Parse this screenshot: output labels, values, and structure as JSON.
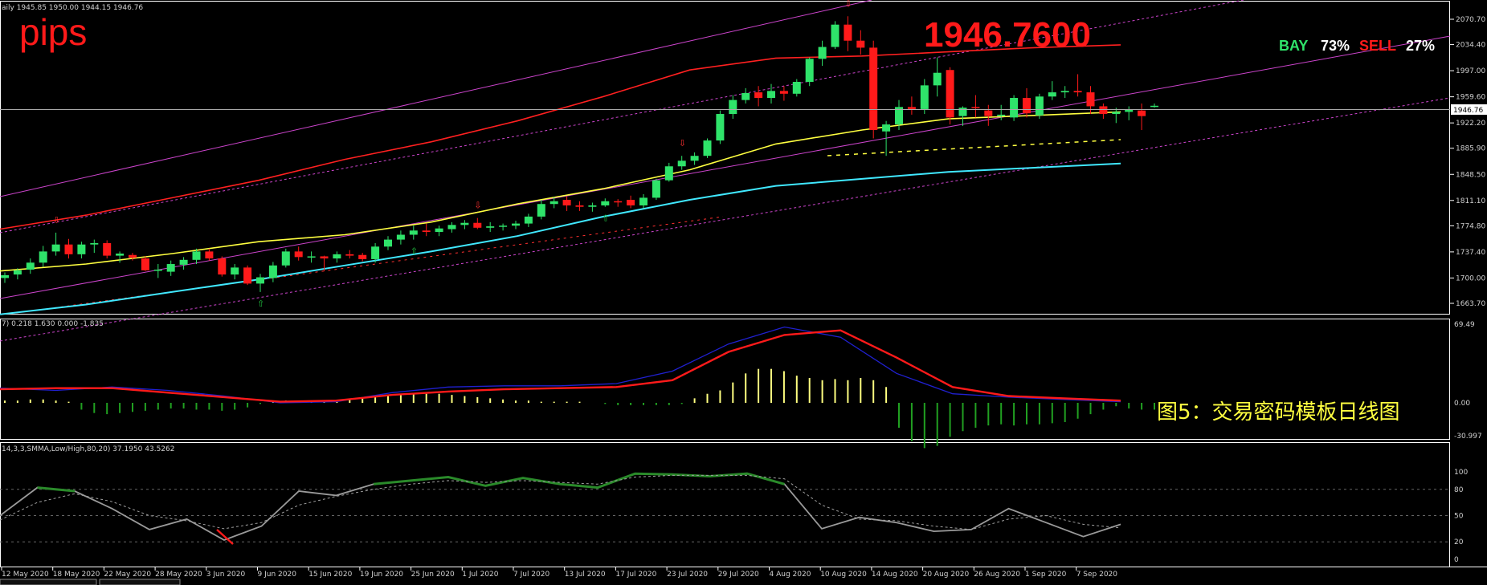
{
  "main_header": "aily  1945.85 1950.00 1944.15 1946.76",
  "watermark": "pips",
  "big_price": "1946.7600",
  "bay_label": "BAY",
  "bay_pct": "73%",
  "sell_label": "SELL",
  "sell_pct": "27%",
  "current_price_tag": "1946.76",
  "macd_header": "7) 0.218 1.630 0.000 -1.835",
  "stoch_header": "14,3,3,SMMA,Low/High,80,20) 37.1950 43.5262",
  "caption": "图5：交易密码模板日线图",
  "colors": {
    "bull": "#2fe36a",
    "bear": "#ff1a1a",
    "ma_fast": "#ffff40",
    "ma_slow": "#ff2020",
    "ma_cyan": "#40e8ff",
    "channel": "#cc44cc",
    "macd_main": "#ff1a1a",
    "macd_signal": "#2020d0",
    "hist_pos": "#ffff80",
    "hist_neg": "#21a021",
    "stoch_main": "#9a9a9a",
    "stoch_hi": "#2a8a2a"
  },
  "chart_data": [
    {
      "type": "candlestick",
      "panel": "price",
      "yticks": [
        "2070.70",
        "2034.40",
        "1997.00",
        "1959.60",
        "1922.20",
        "1885.90",
        "1848.50",
        "1811.10",
        "1774.80",
        "1737.40",
        "1700.00",
        "1663.70"
      ],
      "ylim": [
        1663.7,
        2082
      ],
      "xticks": [
        "12 May 2020",
        "18 May 2020",
        "22 May 2020",
        "28 May 2020",
        "3 Jun 2020",
        "9 Jun 2020",
        "15 Jun 2020",
        "19 Jun 2020",
        "25 Jun 2020",
        "1 Jul 2020",
        "7 Jul 2020",
        "13 Jul 2020",
        "17 Jul 2020",
        "23 Jul 2020",
        "29 Jul 2020",
        "4 Aug 2020",
        "10 Aug 2020",
        "14 Aug 2020",
        "20 Aug 2020",
        "26 Aug 2020",
        "1 Sep 2020",
        "7 Sep 2020"
      ],
      "candles": [
        {
          "o": 1700,
          "h": 1708,
          "l": 1693,
          "c": 1704
        },
        {
          "o": 1705,
          "h": 1714,
          "l": 1698,
          "c": 1711
        },
        {
          "o": 1712,
          "h": 1728,
          "l": 1706,
          "c": 1722
        },
        {
          "o": 1722,
          "h": 1746,
          "l": 1716,
          "c": 1738
        },
        {
          "o": 1738,
          "h": 1765,
          "l": 1732,
          "c": 1748
        },
        {
          "o": 1748,
          "h": 1756,
          "l": 1728,
          "c": 1734
        },
        {
          "o": 1734,
          "h": 1752,
          "l": 1728,
          "c": 1748
        },
        {
          "o": 1748,
          "h": 1755,
          "l": 1736,
          "c": 1750
        },
        {
          "o": 1750,
          "h": 1754,
          "l": 1728,
          "c": 1732
        },
        {
          "o": 1732,
          "h": 1738,
          "l": 1722,
          "c": 1735
        },
        {
          "o": 1733,
          "h": 1736,
          "l": 1725,
          "c": 1729
        },
        {
          "o": 1728,
          "h": 1731,
          "l": 1710,
          "c": 1711
        },
        {
          "o": 1712,
          "h": 1720,
          "l": 1700,
          "c": 1712
        },
        {
          "o": 1709,
          "h": 1725,
          "l": 1703,
          "c": 1720
        },
        {
          "o": 1719,
          "h": 1730,
          "l": 1712,
          "c": 1726
        },
        {
          "o": 1726,
          "h": 1742,
          "l": 1720,
          "c": 1738
        },
        {
          "o": 1738,
          "h": 1742,
          "l": 1725,
          "c": 1728
        },
        {
          "o": 1728,
          "h": 1731,
          "l": 1702,
          "c": 1705
        },
        {
          "o": 1705,
          "h": 1720,
          "l": 1698,
          "c": 1715
        },
        {
          "o": 1715,
          "h": 1718,
          "l": 1690,
          "c": 1692
        },
        {
          "o": 1692,
          "h": 1706,
          "l": 1680,
          "c": 1701
        },
        {
          "o": 1700,
          "h": 1723,
          "l": 1694,
          "c": 1718
        },
        {
          "o": 1718,
          "h": 1742,
          "l": 1715,
          "c": 1738
        },
        {
          "o": 1738,
          "h": 1745,
          "l": 1725,
          "c": 1730
        },
        {
          "o": 1730,
          "h": 1738,
          "l": 1722,
          "c": 1731
        },
        {
          "o": 1731,
          "h": 1732,
          "l": 1710,
          "c": 1728
        },
        {
          "o": 1728,
          "h": 1738,
          "l": 1722,
          "c": 1734
        },
        {
          "o": 1734,
          "h": 1740,
          "l": 1728,
          "c": 1732
        },
        {
          "o": 1733,
          "h": 1736,
          "l": 1724,
          "c": 1727
        },
        {
          "o": 1727,
          "h": 1750,
          "l": 1722,
          "c": 1745
        },
        {
          "o": 1745,
          "h": 1760,
          "l": 1740,
          "c": 1755
        },
        {
          "o": 1755,
          "h": 1768,
          "l": 1748,
          "c": 1762
        },
        {
          "o": 1762,
          "h": 1775,
          "l": 1755,
          "c": 1768
        },
        {
          "o": 1768,
          "h": 1778,
          "l": 1760,
          "c": 1766
        },
        {
          "o": 1766,
          "h": 1775,
          "l": 1760,
          "c": 1771
        },
        {
          "o": 1770,
          "h": 1780,
          "l": 1765,
          "c": 1776
        },
        {
          "o": 1776,
          "h": 1783,
          "l": 1770,
          "c": 1779
        },
        {
          "o": 1779,
          "h": 1786,
          "l": 1770,
          "c": 1772
        },
        {
          "o": 1772,
          "h": 1780,
          "l": 1766,
          "c": 1774
        },
        {
          "o": 1774,
          "h": 1778,
          "l": 1768,
          "c": 1775
        },
        {
          "o": 1775,
          "h": 1782,
          "l": 1770,
          "c": 1778
        },
        {
          "o": 1778,
          "h": 1792,
          "l": 1773,
          "c": 1788
        },
        {
          "o": 1788,
          "h": 1812,
          "l": 1784,
          "c": 1806
        },
        {
          "o": 1806,
          "h": 1816,
          "l": 1800,
          "c": 1810
        },
        {
          "o": 1812,
          "h": 1817,
          "l": 1796,
          "c": 1804
        },
        {
          "o": 1804,
          "h": 1810,
          "l": 1796,
          "c": 1802
        },
        {
          "o": 1802,
          "h": 1808,
          "l": 1795,
          "c": 1804
        },
        {
          "o": 1804,
          "h": 1814,
          "l": 1802,
          "c": 1810
        },
        {
          "o": 1810,
          "h": 1813,
          "l": 1802,
          "c": 1809
        },
        {
          "o": 1812,
          "h": 1818,
          "l": 1800,
          "c": 1804
        },
        {
          "o": 1804,
          "h": 1820,
          "l": 1800,
          "c": 1815
        },
        {
          "o": 1815,
          "h": 1842,
          "l": 1812,
          "c": 1840
        },
        {
          "o": 1840,
          "h": 1865,
          "l": 1838,
          "c": 1860
        },
        {
          "o": 1860,
          "h": 1875,
          "l": 1855,
          "c": 1868
        },
        {
          "o": 1868,
          "h": 1880,
          "l": 1862,
          "c": 1875
        },
        {
          "o": 1875,
          "h": 1900,
          "l": 1872,
          "c": 1897
        },
        {
          "o": 1897,
          "h": 1940,
          "l": 1892,
          "c": 1935
        },
        {
          "o": 1935,
          "h": 1962,
          "l": 1928,
          "c": 1955
        },
        {
          "o": 1955,
          "h": 1972,
          "l": 1950,
          "c": 1965
        },
        {
          "o": 1966,
          "h": 1975,
          "l": 1946,
          "c": 1958
        },
        {
          "o": 1958,
          "h": 1978,
          "l": 1950,
          "c": 1968
        },
        {
          "o": 1968,
          "h": 1975,
          "l": 1954,
          "c": 1964
        },
        {
          "o": 1964,
          "h": 1985,
          "l": 1960,
          "c": 1981
        },
        {
          "o": 1981,
          "h": 2016,
          "l": 1975,
          "c": 2014
        },
        {
          "o": 2014,
          "h": 2040,
          "l": 2004,
          "c": 2031
        },
        {
          "o": 2031,
          "h": 2068,
          "l": 2028,
          "c": 2063
        },
        {
          "o": 2063,
          "h": 2075,
          "l": 2025,
          "c": 2040
        },
        {
          "o": 2040,
          "h": 2055,
          "l": 2020,
          "c": 2030
        },
        {
          "o": 2030,
          "h": 2040,
          "l": 1900,
          "c": 1912
        },
        {
          "o": 1910,
          "h": 1925,
          "l": 1875,
          "c": 1920
        },
        {
          "o": 1920,
          "h": 1955,
          "l": 1912,
          "c": 1945
        },
        {
          "o": 1945,
          "h": 1960,
          "l": 1934,
          "c": 1942
        },
        {
          "o": 1942,
          "h": 1985,
          "l": 1935,
          "c": 1976
        },
        {
          "o": 1976,
          "h": 2016,
          "l": 1960,
          "c": 1994
        },
        {
          "o": 1998,
          "h": 2002,
          "l": 1920,
          "c": 1930
        },
        {
          "o": 1932,
          "h": 1946,
          "l": 1918,
          "c": 1944
        },
        {
          "o": 1945,
          "h": 1962,
          "l": 1930,
          "c": 1944
        },
        {
          "o": 1940,
          "h": 1948,
          "l": 1918,
          "c": 1932
        },
        {
          "o": 1932,
          "h": 1948,
          "l": 1926,
          "c": 1934
        },
        {
          "o": 1930,
          "h": 1962,
          "l": 1925,
          "c": 1958
        },
        {
          "o": 1958,
          "h": 1972,
          "l": 1930,
          "c": 1936
        },
        {
          "o": 1933,
          "h": 1964,
          "l": 1928,
          "c": 1960
        },
        {
          "o": 1960,
          "h": 1982,
          "l": 1955,
          "c": 1966
        },
        {
          "o": 1966,
          "h": 1975,
          "l": 1958,
          "c": 1968
        },
        {
          "o": 1968,
          "h": 1992,
          "l": 1960,
          "c": 1966
        },
        {
          "o": 1966,
          "h": 1975,
          "l": 1935,
          "c": 1946
        },
        {
          "o": 1946,
          "h": 1950,
          "l": 1928,
          "c": 1935
        },
        {
          "o": 1935,
          "h": 1944,
          "l": 1922,
          "c": 1938
        },
        {
          "o": 1938,
          "h": 1946,
          "l": 1926,
          "c": 1942
        },
        {
          "o": 1940,
          "h": 1950,
          "l": 1912,
          "c": 1932
        },
        {
          "o": 1945.85,
          "h": 1950.0,
          "l": 1944.15,
          "c": 1946.76
        }
      ],
      "series": [
        {
          "name": "",
          "color": "#ffff40",
          "points": [
            1710,
            1720,
            1735,
            1752,
            1762,
            1780,
            1806,
            1828,
            1855,
            1892,
            1912,
            1928,
            1933,
            1938
          ]
        },
        {
          "name": "",
          "color": "#ff2020",
          "points": [
            1770,
            1790,
            1815,
            1840,
            1870,
            1895,
            1925,
            1960,
            1998,
            2015,
            2018,
            2024,
            2030,
            2034
          ]
        },
        {
          "name": "",
          "color": "#40e8ff",
          "points": [
            1648,
            1662,
            1680,
            1698,
            1718,
            1738,
            1760,
            1788,
            1812,
            1832,
            1842,
            1852,
            1858,
            1864
          ]
        }
      ]
    },
    {
      "type": "line",
      "panel": "macd",
      "yticks": [
        "69.49",
        "0.00",
        "-30.997"
      ],
      "ylim": [
        -30.997,
        69.49
      ],
      "series": [
        {
          "name": "",
          "points": [
            13,
            11,
            14,
            11,
            6,
            0,
            1,
            9,
            14,
            15,
            15,
            17,
            28,
            52,
            67,
            58,
            26,
            8,
            5,
            3,
            1
          ]
        },
        {
          "name": "",
          "points": [
            12,
            13,
            13,
            9,
            5,
            1,
            2,
            7,
            10,
            12,
            13,
            14,
            20,
            45,
            60,
            64,
            40,
            14,
            6,
            4,
            2
          ]
        }
      ]
    },
    {
      "type": "line",
      "panel": "stochastic",
      "yticks": [
        "100",
        "80",
        "50",
        "20",
        "0"
      ],
      "ylim": [
        0,
        100
      ],
      "series": [
        {
          "name": "",
          "points": [
            50,
            82,
            78,
            58,
            34,
            46,
            22,
            38,
            78,
            73,
            86,
            90,
            94,
            84,
            93,
            86,
            82,
            98,
            97,
            95,
            98,
            86,
            35,
            48,
            42,
            32,
            34,
            58,
            42,
            26,
            40
          ]
        },
        {
          "name": "",
          "points": [
            45,
            65,
            75,
            66,
            50,
            44,
            35,
            42,
            62,
            72,
            80,
            86,
            90,
            88,
            90,
            88,
            86,
            94,
            96,
            96,
            96,
            92,
            62,
            46,
            44,
            38,
            34,
            46,
            50,
            40,
            36
          ]
        }
      ]
    }
  ]
}
